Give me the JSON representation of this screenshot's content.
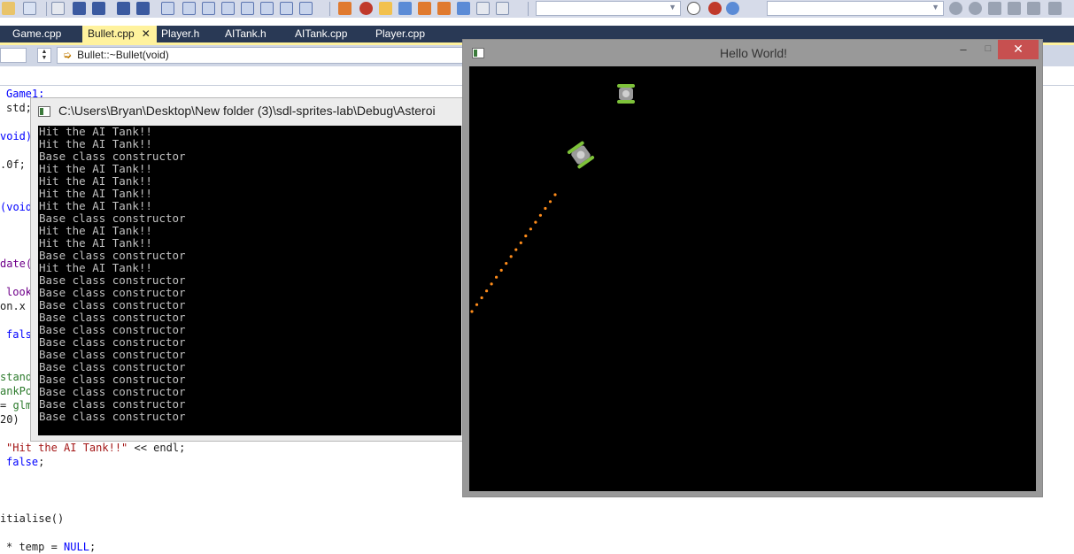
{
  "ide": {
    "tabs": [
      {
        "label": "Game.cpp"
      },
      {
        "label": "Bullet.cpp",
        "active": true
      },
      {
        "label": "Player.h"
      },
      {
        "label": "AITank.h"
      },
      {
        "label": "AITank.cpp"
      },
      {
        "label": "Player.cpp"
      }
    ],
    "tab_close_glyph": "✕",
    "navbar": {
      "member": "Bullet::~Bullet(void)"
    },
    "code_fragments": {
      "l1": "Game1;",
      "l2": "std;",
      "l3": "void)",
      "l4": ".0f;",
      "l5": "(void",
      "l6": "date(",
      "l7": "look",
      "l8": "on.x",
      "l9": "fals",
      "l10": "stand",
      "l11": "ankPo",
      "l12a": "=",
      "l12b": "glm",
      "l13": "20)",
      "l14_str": "\"Hit the AI Tank!!\"",
      "l14_rest": " << endl;",
      "l15_kw": "false",
      "l15_rest": ";",
      "l16": "itialise()",
      "l17_a": "* temp = ",
      "l17_kw": "NULL",
      "l17_b": ";"
    }
  },
  "console": {
    "title": "C:\\Users\\Bryan\\Desktop\\New folder (3)\\sdl-sprites-lab\\Debug\\Asteroi",
    "lines": [
      "Hit the AI Tank!!",
      "Hit the AI Tank!!",
      "Base class constructor",
      "Hit the AI Tank!!",
      "Hit the AI Tank!!",
      "Hit the AI Tank!!",
      "Hit the AI Tank!!",
      "Base class constructor",
      "Hit the AI Tank!!",
      "Hit the AI Tank!!",
      "Base class constructor",
      "Hit the AI Tank!!",
      "Base class constructor",
      "Base class constructor",
      "Base class constructor",
      "Base class constructor",
      "Base class constructor",
      "Base class constructor",
      "Base class constructor",
      "Base class constructor",
      "Base class constructor",
      "Base class constructor",
      "Base class constructor",
      "Base class constructor"
    ]
  },
  "game_window": {
    "title": "Hello World!",
    "min_glyph": "–",
    "max_glyph": "□",
    "close_glyph": "✕",
    "bullet_count": 18,
    "colors": {
      "bullet": "#ff8c1a",
      "tank_body": "#9a9a9a",
      "tank_tread": "#7ec23a"
    }
  }
}
